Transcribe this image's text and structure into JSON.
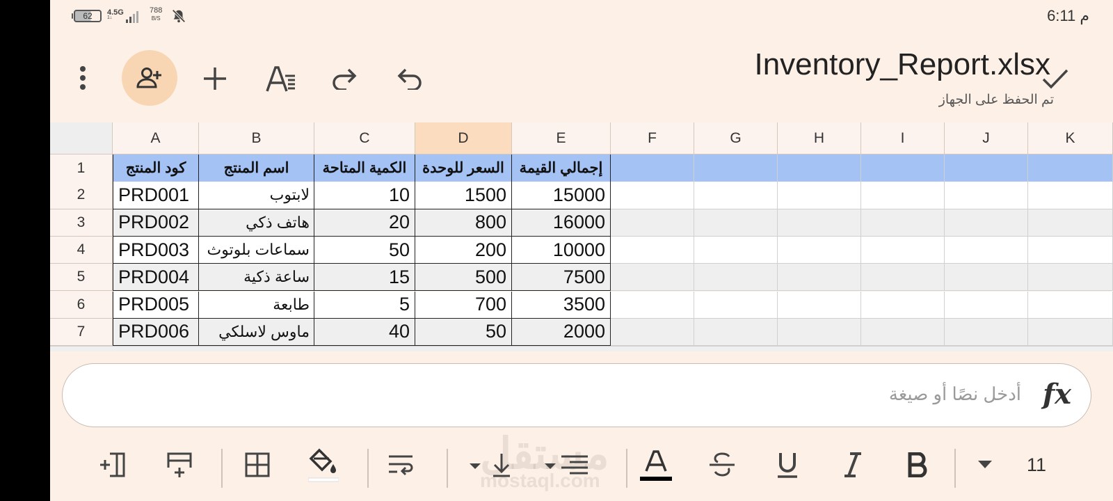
{
  "status_bar": {
    "battery": "62",
    "network": "4.5G",
    "network_sub": "1↓",
    "speed_value": "788",
    "speed_unit": "B/S",
    "time": "6:11 م"
  },
  "header": {
    "file_name": "Inventory_Report.xlsx",
    "save_status": "تم الحفظ على الجهاز"
  },
  "columns": [
    "A",
    "B",
    "C",
    "D",
    "E",
    "F",
    "G",
    "H",
    "I",
    "J",
    "K"
  ],
  "selected_column": "D",
  "rows": [
    {
      "num": "1",
      "cells": [
        "كود المنتج",
        "اسم المنتج",
        "الكمية المتاحة",
        "السعر للوحدة",
        "إجمالي القيمة"
      ]
    },
    {
      "num": "2",
      "cells": [
        "PRD001",
        "لابتوب",
        "10",
        "1500",
        "15000"
      ]
    },
    {
      "num": "3",
      "cells": [
        "PRD002",
        "هاتف ذكي",
        "20",
        "800",
        "16000"
      ]
    },
    {
      "num": "4",
      "cells": [
        "PRD003",
        "سماعات بلوتوث",
        "50",
        "200",
        "10000"
      ]
    },
    {
      "num": "5",
      "cells": [
        "PRD004",
        "ساعة ذكية",
        "15",
        "500",
        "7500"
      ]
    },
    {
      "num": "6",
      "cells": [
        "PRD005",
        "طابعة",
        "5",
        "700",
        "3500"
      ]
    },
    {
      "num": "7",
      "cells": [
        "PRD006",
        "ماوس لاسلكي",
        "40",
        "50",
        "2000"
      ]
    }
  ],
  "formula_bar": {
    "placeholder": "أدخل نصًا أو صيغة",
    "fx_label": "fx"
  },
  "toolbar": {
    "font_size": "11"
  },
  "watermark": {
    "arabic": "مستقل",
    "latin": "mostaql.com"
  },
  "colors": {
    "background": "#fdf0e6",
    "header_row": "#a4c2f4",
    "selected_column": "#fcdcbf",
    "share_button": "#f8d6b4",
    "alt_row": "#efefef"
  }
}
